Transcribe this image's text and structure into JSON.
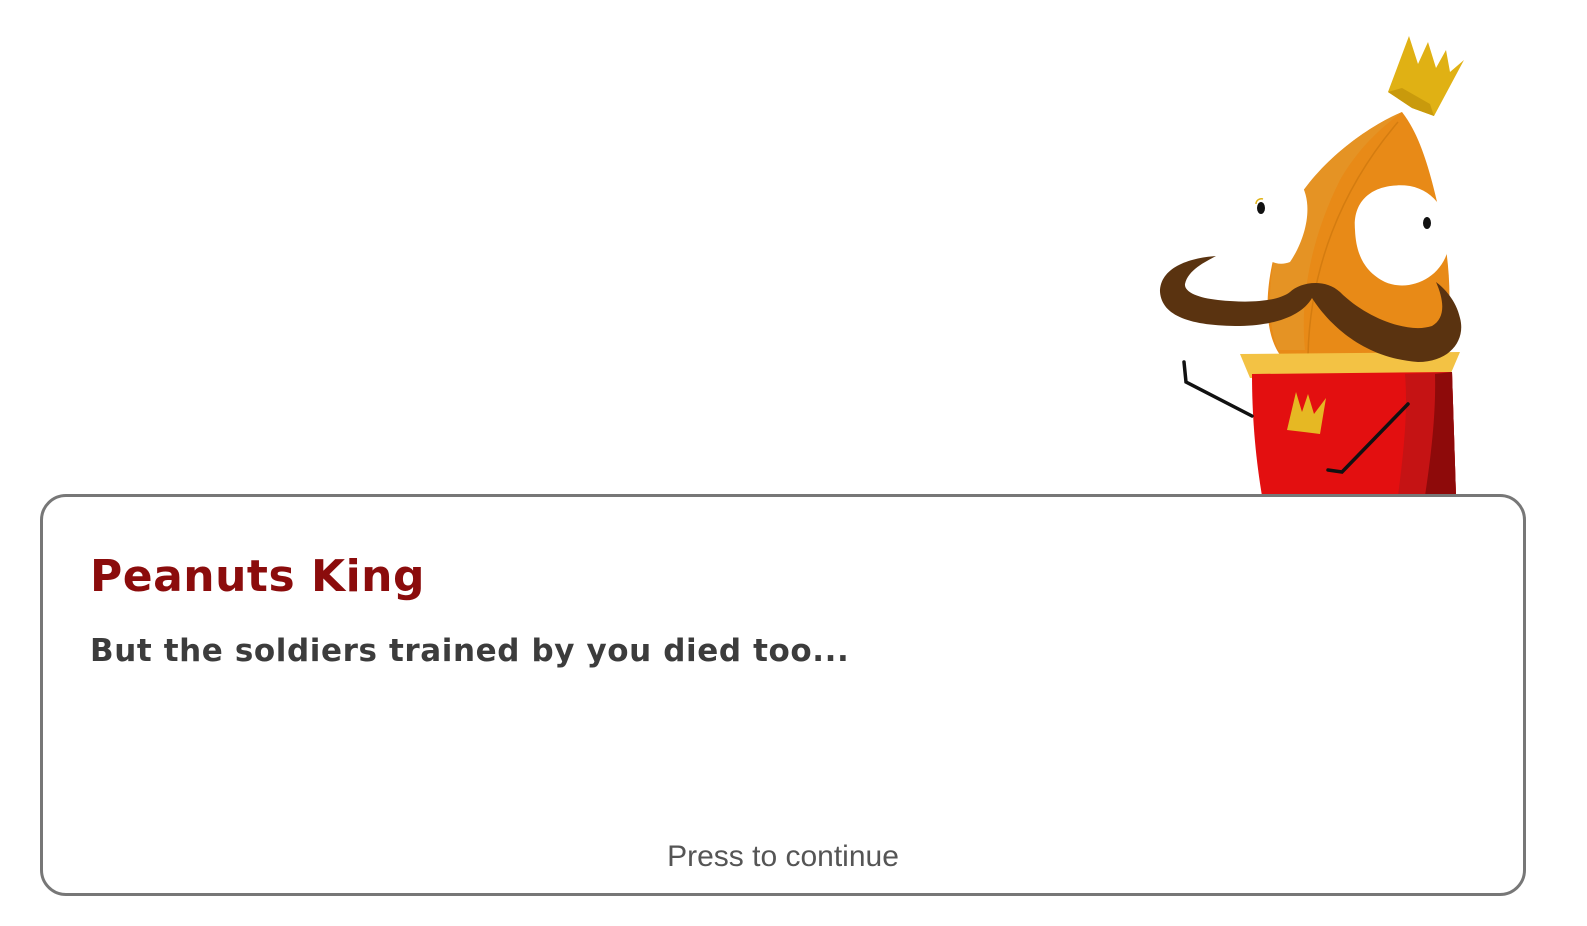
{
  "dialog": {
    "speaker": "Peanuts King",
    "text": "But the soldiers trained by you died too...",
    "continue_prompt": "Press to continue"
  },
  "character": {
    "name": "peanuts-king",
    "icon": "peanut-king-character"
  },
  "colors": {
    "speaker": "#8b0c0c",
    "text": "#3c3c3c",
    "prompt": "#555555",
    "border": "#777777",
    "peanut": "#e88a17",
    "crown": "#e0b114",
    "mustache": "#5a3310",
    "robe": "#e30f10",
    "collar": "#f3c244"
  }
}
